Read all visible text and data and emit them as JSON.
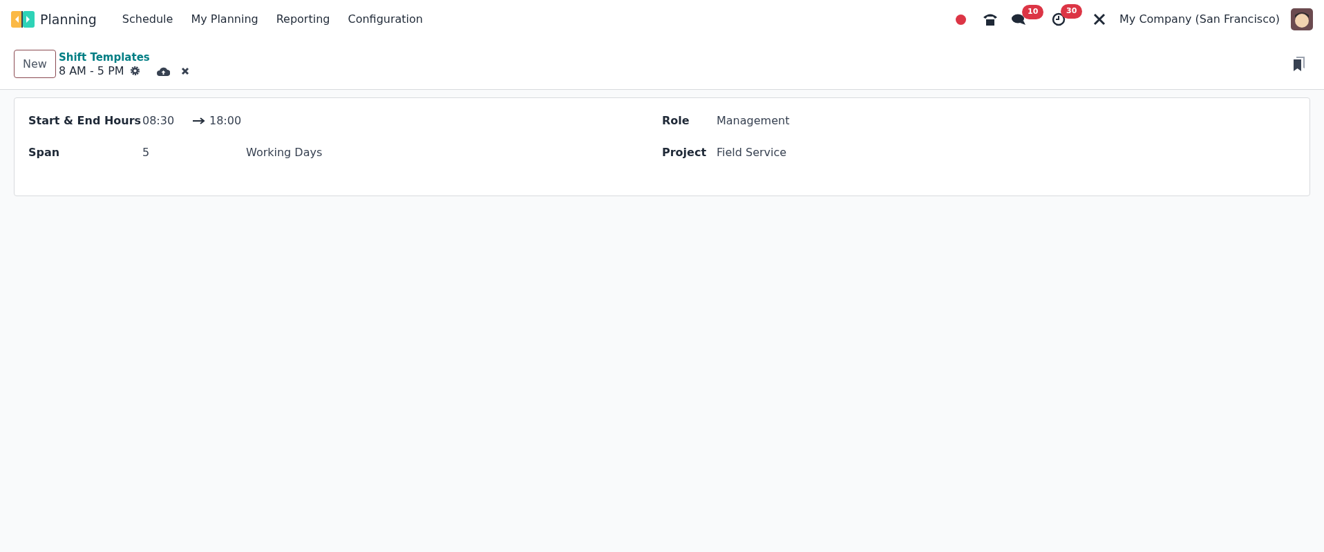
{
  "navbar": {
    "app_name": "Planning",
    "menu": [
      "Schedule",
      "My Planning",
      "Reporting",
      "Configuration"
    ],
    "chat_count": "10",
    "activity_count": "30",
    "company": "My Company (San Francisco)"
  },
  "control_panel": {
    "new_button": "New",
    "breadcrumb": "Shift Templates",
    "record_name": "8 AM - 5 PM"
  },
  "form": {
    "start_end": {
      "label": "Start & End Hours",
      "start": "08:30",
      "end": "18:00"
    },
    "span": {
      "label": "Span",
      "value": "5",
      "unit": "Working Days"
    },
    "role": {
      "label": "Role",
      "value": "Management"
    },
    "project": {
      "label": "Project",
      "value": "Field Service"
    }
  }
}
